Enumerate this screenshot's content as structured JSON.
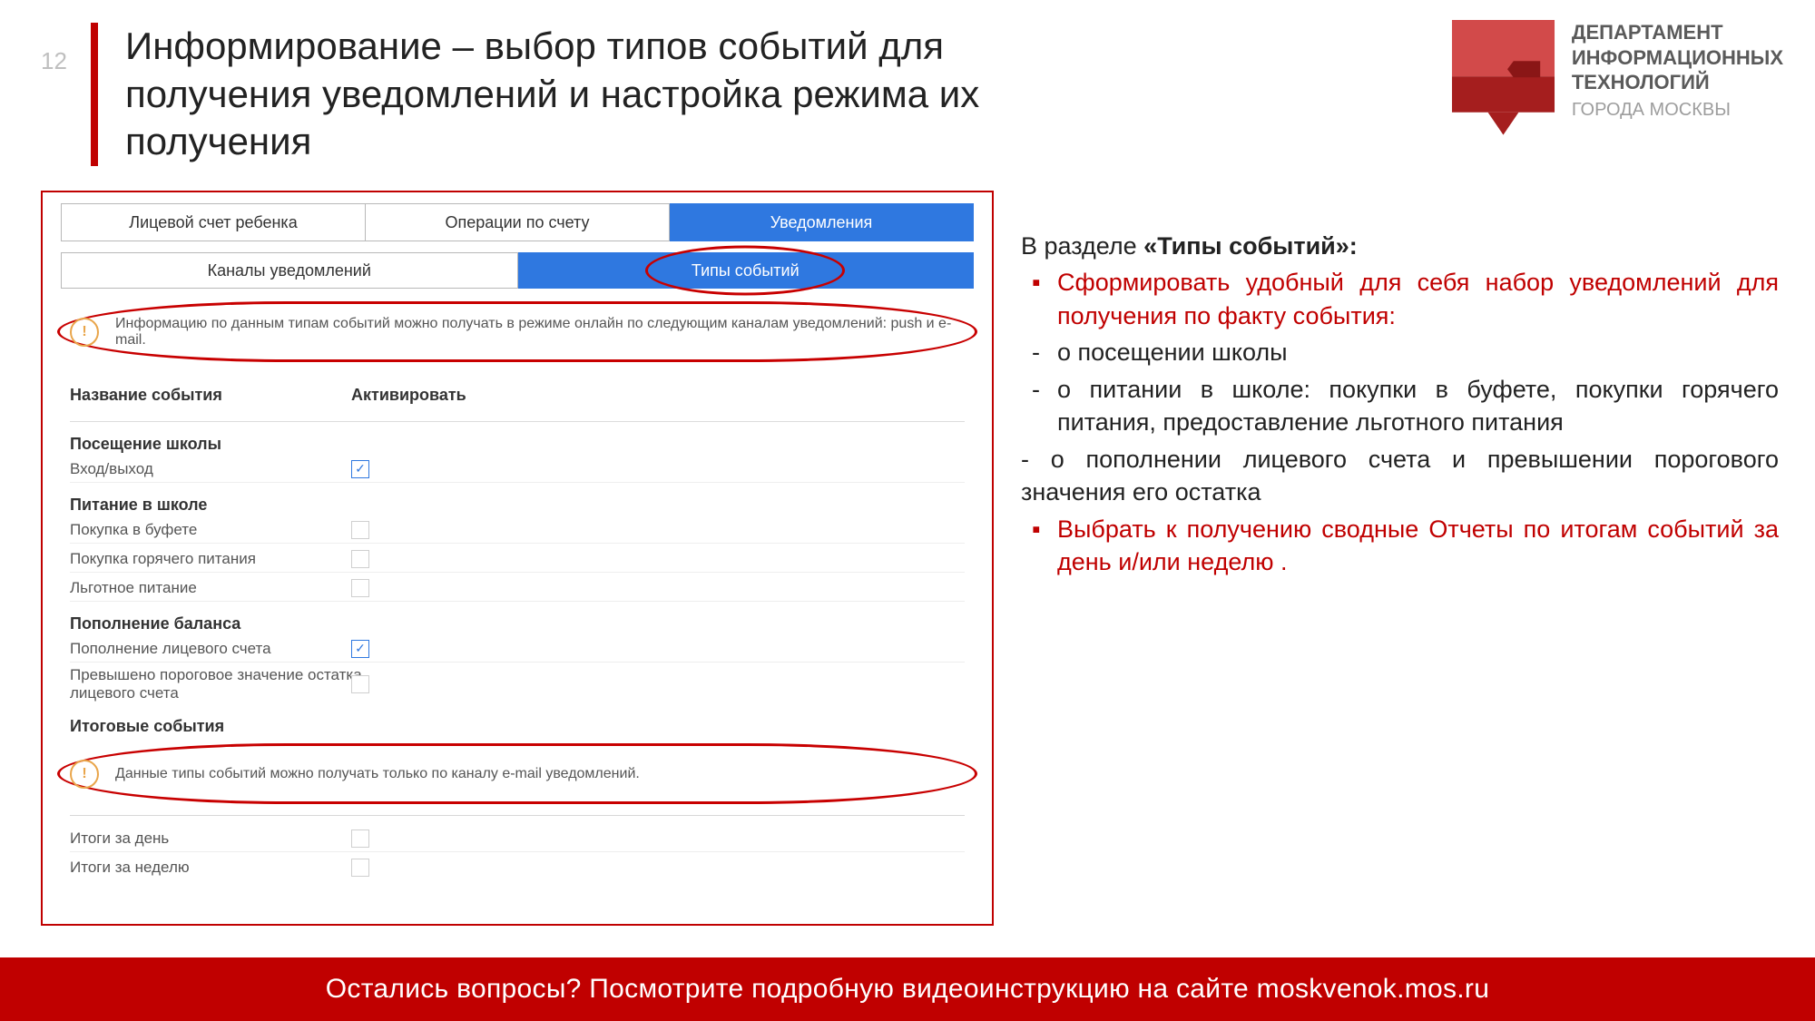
{
  "page_number": "12",
  "title": "Информирование – выбор типов событий для получения уведомлений и настройка режима их получения",
  "logo": {
    "line1": "ДЕПАРТАМЕНТ",
    "line2": "ИНФОРМАЦИОННЫХ",
    "line3": "ТЕХНОЛОГИЙ",
    "line4": "ГОРОДА МОСКВЫ"
  },
  "tabs_top": {
    "t1": "Лицевой счет ребенка",
    "t2": "Операции по счету",
    "t3": "Уведомления"
  },
  "tabs_sub": {
    "s1": "Каналы уведомлений",
    "s2": "Типы событий"
  },
  "info1": "Информацию по данным типам событий можно получать в режиме онлайн по следующим каналам уведомлений: push и e-mail.",
  "cols": {
    "name": "Название события",
    "act": "Активировать"
  },
  "groups": {
    "g1": "Посещение школы",
    "g1r1": "Вход/выход",
    "g2": "Питание в школе",
    "g2r1": "Покупка в буфете",
    "g2r2": "Покупка горячего питания",
    "g2r3": "Льготное питание",
    "g3": "Пополнение баланса",
    "g3r1": "Пополнение лицевого счета",
    "g3r2": "Превышено пороговое значение остатка лицевого счета",
    "g4": "Итоговые события"
  },
  "info2": "Данные типы событий можно получать только по каналу e-mail уведомлений.",
  "final": {
    "r1": "Итоги за день",
    "r2": "Итоги за неделю"
  },
  "tick": "✓",
  "right": {
    "intro_a": "В разделе ",
    "intro_b": "«Типы событий»:",
    "b1": "Сформировать удобный для себя набор уведомлений для получения по факту события:",
    "d1": "о посещении школы",
    "d2": "о питании в школе: покупки в буфете, покупки горячего питания, предоставление льготного питания",
    "d3": "- о пополнении лицевого счета и превышении порогового значения его остатка",
    "b2": "Выбрать к получению сводные Отчеты по итогам событий за день и/или неделю ."
  },
  "footer": "Остались вопросы? Посмотрите подробную видеоинструкцию на сайте moskvenok.mos.ru"
}
